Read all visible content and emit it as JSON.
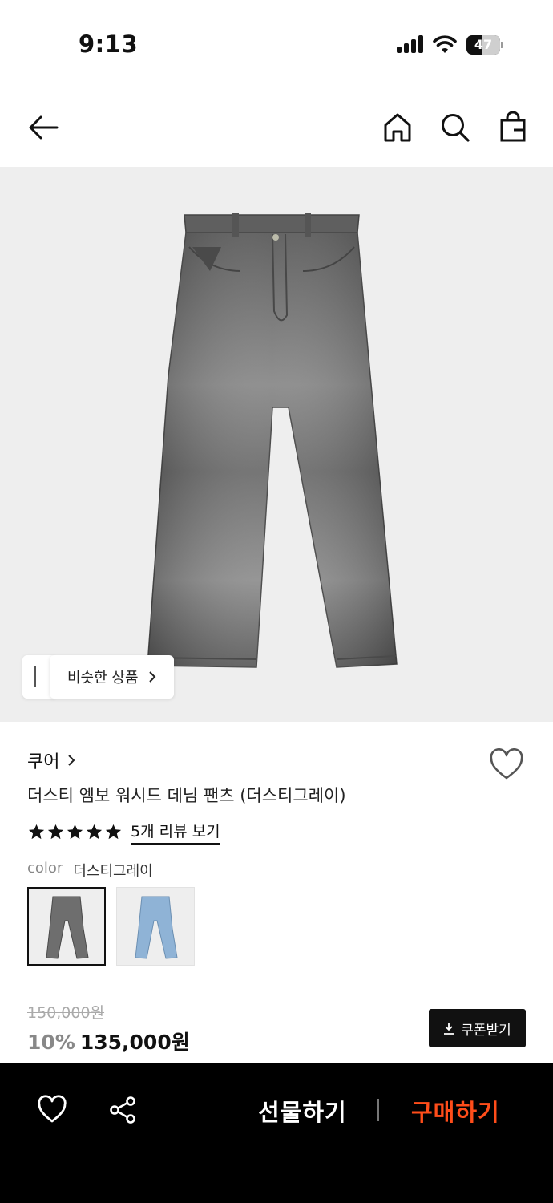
{
  "status_bar": {
    "time": "9:13",
    "battery_level": "47",
    "battery_fraction": 0.47
  },
  "nav": {
    "icons": [
      "back-arrow-icon",
      "home-icon",
      "search-icon",
      "shopping-bag-icon"
    ]
  },
  "image": {
    "similar_label": "비슷한 상품"
  },
  "product": {
    "brand": "쿠어",
    "name": "더스티 엠보 워시드 데님 팬츠 (더스티그레이)",
    "rating_stars": 5,
    "review_link": "5개 리뷰 보기",
    "color_label": "color",
    "color_value": "더스티그레이",
    "swatches": [
      "더스티그레이",
      "블루"
    ]
  },
  "price": {
    "original": "150,000원",
    "discount": "10%",
    "sale": "135,000원",
    "coupon_label": "쿠폰받기"
  },
  "bottom_bar": {
    "gift_label": "선물하기",
    "buy_label": "구매하기"
  },
  "colors": {
    "accent": "#ff4d1a",
    "bar_bg": "#000000",
    "image_bg": "#eeeeee"
  }
}
